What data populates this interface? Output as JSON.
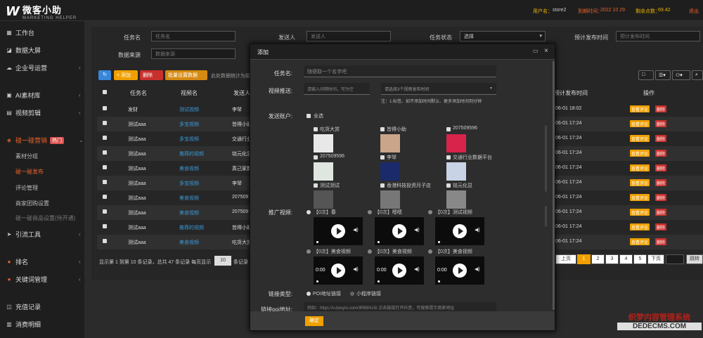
{
  "header": {
    "logo_main": "微客小助",
    "logo_sub": "MARKETING HELPER",
    "user_label": "用户名：",
    "user_value": "store2",
    "expire_label": "到期时间：",
    "expire_value": "2022 10 29",
    "points_label": "剩余点数：",
    "points_value": "69.42",
    "logout": "退出"
  },
  "sidebar": {
    "items": [
      {
        "icon": "grid-icon",
        "label": "工作台"
      },
      {
        "icon": "chart-icon",
        "label": "数据大屏"
      },
      {
        "icon": "cloud-icon",
        "label": "企业号运营"
      },
      {
        "icon": "bag-icon",
        "label": "AI素材库"
      },
      {
        "icon": "film-icon",
        "label": "视频剪辑"
      },
      {
        "icon": "promo-icon",
        "label": "碰一碰营销",
        "badge": "热门"
      },
      {
        "icon": "link-icon",
        "label": "引流工具"
      },
      {
        "icon": "rank-icon",
        "label": "排名"
      },
      {
        "icon": "user-icon",
        "label": "关键词管理"
      },
      {
        "icon": "wallet-icon",
        "label": "充值记录"
      },
      {
        "icon": "doc-icon",
        "label": "消费明细"
      }
    ],
    "subitems": [
      "素材分组",
      "碰一碰发布",
      "评论管理",
      "商家团购设置",
      "碰一碰商品设置(待开通)"
    ]
  },
  "filters": {
    "task_name_label": "任务名",
    "task_name_placeholder": "任务名",
    "sender_label": "发送人",
    "sender_placeholder": "发送人",
    "status_label": "任务状态",
    "status_value": "选择",
    "time_label": "预计发布时间",
    "time_placeholder": "预计发布时间",
    "source_label": "数据来源",
    "source_placeholder": "数据来源"
  },
  "toolbar": {
    "refresh": "↻",
    "add": "+ 添加",
    "delete": "删除",
    "batch": "批量设置数据",
    "hint": "此处数据统计为碰一碰发布列表"
  },
  "table": {
    "headers": [
      "任务名",
      "视频名",
      "发送人",
      "预计发布时间",
      "操作"
    ],
    "rows": [
      {
        "task": "发财",
        "video": "测试视频",
        "sender": "李琴",
        "time": "06-01 18:02"
      },
      {
        "task": "测试aaa",
        "video": "多宝视频",
        "sender": "皆得小助",
        "time": "06-01 17:24"
      },
      {
        "task": "测试aaa",
        "video": "多宝视频",
        "sender": "交通行业数据",
        "time": "06-01 17:24"
      },
      {
        "task": "测试aaa",
        "video": "推荐的视频",
        "sender": "铭元化显",
        "time": "06-01 17:24"
      },
      {
        "task": "测试aaa",
        "video": "美食视频",
        "sender": "真己家数据软件",
        "time": "06-01 17:24"
      },
      {
        "task": "测试aaa",
        "video": "多宝视频",
        "sender": "李琴",
        "time": "06-01 17:24"
      },
      {
        "task": "测试aaa",
        "video": "美食视频",
        "sender": "207509",
        "time": "06-01 17:24"
      },
      {
        "task": "测试aaa",
        "video": "美食视频",
        "sender": "207509",
        "time": "06-01 17:24"
      },
      {
        "task": "测试aaa",
        "video": "推荐的视频",
        "sender": "皆得小助",
        "time": "06-01 17:24"
      },
      {
        "task": "测试aaa",
        "video": "美食视频",
        "sender": "吃货大赏",
        "time": "06-01 17:24"
      }
    ],
    "op_edit": "查看评论",
    "op_delete": "删除",
    "footer_text": "显示第 1 到第 10 条记录，总共 47 条记录 每页显示",
    "page_size": "10",
    "footer_tail": "条记录",
    "pages": [
      "上页",
      "1",
      "2",
      "3",
      "4",
      "5",
      "下页"
    ],
    "jump": "跳转"
  },
  "modal": {
    "title": "添加",
    "task_label": "任务名:",
    "task_placeholder": "随便取一个名字吧",
    "time_label": "视频推送:",
    "time_placeholder": "请输入间隔时间，可为空",
    "time_select": "请选择3个视频发布时间",
    "time_note": "注：1.标签、如不添加时间默认、更多添加时间到分钟",
    "sender_label": "发送账户:",
    "select_all": "全选",
    "accounts": [
      {
        "name": "吃货大赏",
        "color": "#e8e8e8"
      },
      {
        "name": "皆得小助",
        "color": "#caa58a"
      },
      {
        "name": "207509596",
        "color": "#d8234a"
      },
      {
        "name": "207509596",
        "color": "#dfe6df"
      },
      {
        "name": "李琴",
        "color": "#1a2a6a"
      },
      {
        "name": "交通行业数据平台",
        "color": "#c8d4e6"
      },
      {
        "name": "测试测试",
        "color": "#555"
      },
      {
        "name": "香港科技投资月子店",
        "color": "#777"
      },
      {
        "name": "铭元化显",
        "color": "#888"
      }
    ],
    "video_label": "推广视频:",
    "videos": [
      {
        "label": "【0次】春",
        "time": ""
      },
      {
        "label": "【0次】嗯嗯",
        "time": ""
      },
      {
        "label": "【0次】测试视频",
        "time": ""
      },
      {
        "label": "【0次】美食视频",
        "time": "0:00"
      },
      {
        "label": "【0次】美食视频",
        "time": "0:00"
      },
      {
        "label": "【0次】美食视频",
        "time": "0:00"
      }
    ],
    "link_label": "链接类型:",
    "link_opt1": "POI地址链接",
    "link_opt2": "小程序链接",
    "url_label": "链接poi地址:",
    "url_placeholder": "例如：https://v.douyin.com/3RB9Xc5/ 点击链接打开抖音，可搜索提示商家地址",
    "submit": "确定",
    "min_icon": "▭",
    "close_icon": "×"
  },
  "watermark": {
    "line1": "织梦内容管理系统",
    "line2": "DEDECMS.COM"
  }
}
